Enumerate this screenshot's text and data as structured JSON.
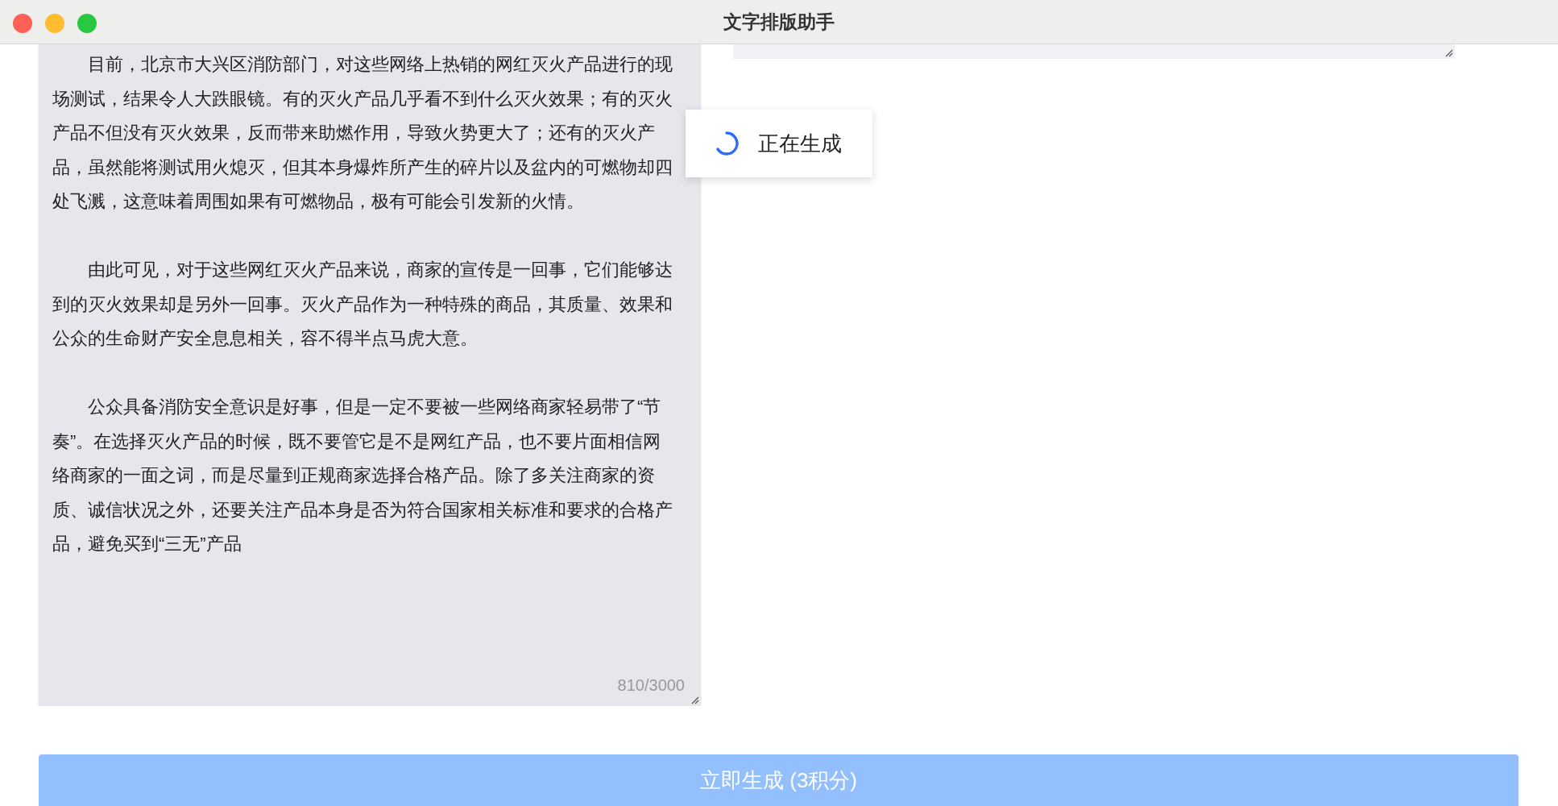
{
  "window": {
    "title": "文字排版助手"
  },
  "source_text": {
    "paragraphs": [
      "目前，北京市大兴区消防部门，对这些网络上热销的网红灭火产品进行的现场测试，结果令人大跌眼镜。有的灭火产品几乎看不到什么灭火效果；有的灭火产品不但没有灭火效果，反而带来助燃作用，导致火势更大了；还有的灭火产品，虽然能将测试用火熄灭，但其本身爆炸所产生的碎片以及盆内的可燃物却四处飞溅，这意味着周围如果有可燃物品，极有可能会引发新的火情。",
      "由此可见，对于这些网红灭火产品来说，商家的宣传是一回事，它们能够达到的灭火效果却是另外一回事。灭火产品作为一种特殊的商品，其质量、效果和公众的生命财产安全息息相关，容不得半点马虎大意。",
      "公众具备消防安全意识是好事，但是一定不要被一些网络商家轻易带了“节奏”。在选择灭火产品的时候，既不要管它是不是网红产品，也不要片面相信网络商家的一面之词，而是尽量到正规商家选择合格产品。除了多关注商家的资质、诚信状况之外，还要关注产品本身是否为符合国家相关标准和要求的合格产品，避免买到“三无”产品"
    ],
    "counter": "810/3000"
  },
  "toast": {
    "kind": "loading",
    "message": "正在生成"
  },
  "generate_button": {
    "label": "立即生成 (3积分)",
    "disabled": true
  }
}
